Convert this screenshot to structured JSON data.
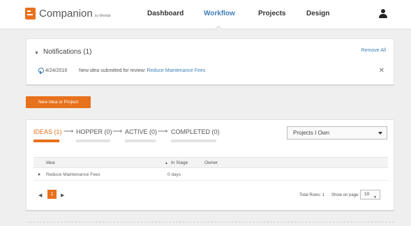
{
  "brand": {
    "name": "Companion",
    "sub": "by Minitab"
  },
  "nav": {
    "items": [
      {
        "label": "Dashboard",
        "active": false
      },
      {
        "label": "Workflow",
        "active": true
      },
      {
        "label": "Projects",
        "active": false
      },
      {
        "label": "Design",
        "active": false
      }
    ]
  },
  "notifications": {
    "title": "Notifications (1)",
    "remove_all": "Remove All",
    "items": [
      {
        "date": "4/24/2019",
        "text": "New idea submitted for review:",
        "link": "Reduce Maintenance Fees"
      }
    ]
  },
  "actions": {
    "new_button": "New Idea or Project"
  },
  "pipeline": {
    "stages": [
      {
        "label": "IDEAS (1)",
        "active": true
      },
      {
        "label": "HOPPER (0)",
        "active": false
      },
      {
        "label": "ACTIVE (0)",
        "active": false
      },
      {
        "label": "COMPLETED (0)",
        "active": false
      }
    ],
    "filter": {
      "selected": "Projects I Own"
    }
  },
  "table": {
    "columns": [
      "Idea",
      "In Stage",
      "Owner"
    ],
    "sort_indicator": "▲",
    "rows": [
      {
        "idea": "Reduce Maintenance Fees",
        "in_stage": "0 days",
        "owner": ""
      }
    ]
  },
  "pager": {
    "prev": "◀",
    "next": "▶",
    "current_page": "1",
    "total_rows": "Total Rows: 1",
    "show_label": "Show on page:",
    "page_size": "10"
  },
  "colors": {
    "accent": "#e8711c",
    "link": "#3d7fb8"
  }
}
